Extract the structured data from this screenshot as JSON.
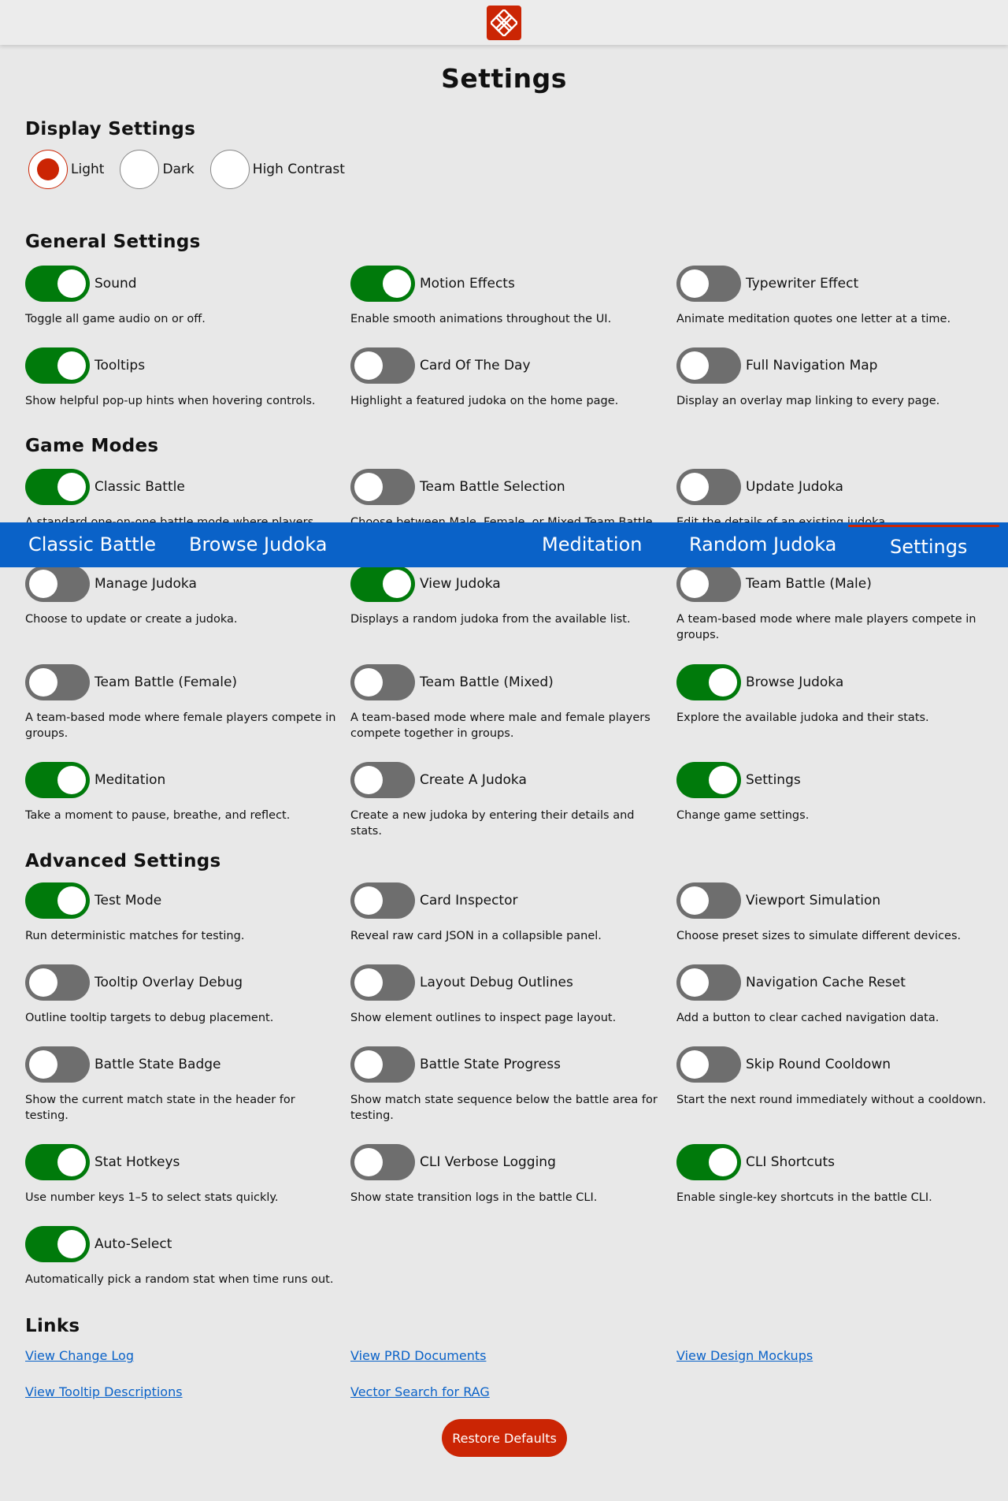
{
  "header": {
    "logo": "knot-logo-icon"
  },
  "page_title": "Settings",
  "display": {
    "title": "Display Settings",
    "modes": [
      {
        "label": "Light",
        "checked": true
      },
      {
        "label": "Dark",
        "checked": false
      },
      {
        "label": "High Contrast",
        "checked": false
      }
    ]
  },
  "general": {
    "title": "General Settings",
    "items": [
      {
        "label": "Sound",
        "desc": "Toggle all game audio on or off.",
        "on": true
      },
      {
        "label": "Motion Effects",
        "desc": "Enable smooth animations throughout the UI.",
        "on": true
      },
      {
        "label": "Typewriter Effect",
        "desc": "Animate meditation quotes one letter at a time.",
        "on": false
      },
      {
        "label": "Tooltips",
        "desc": "Show helpful pop-up hints when hovering controls.",
        "on": true
      },
      {
        "label": "Card Of The Day",
        "desc": "Highlight a featured judoka on the home page.",
        "on": false
      },
      {
        "label": "Full Navigation Map",
        "desc": "Display an overlay map linking to every page.",
        "on": false
      }
    ]
  },
  "game_modes": {
    "title": "Game Modes",
    "items": [
      {
        "label": "Classic Battle",
        "desc": "A standard one-on-one battle mode where players",
        "on": true
      },
      {
        "label": "Team Battle Selection",
        "desc": "Choose between Male, Female, or Mixed Team Battle",
        "on": false
      },
      {
        "label": "Update Judoka",
        "desc": "Edit the details of an existing judoka.",
        "on": false
      },
      {
        "label": "Manage Judoka",
        "desc": "Choose to update or create a judoka.",
        "on": false
      },
      {
        "label": "View Judoka",
        "desc": "Displays a random judoka from the available list.",
        "on": true
      },
      {
        "label": "Team Battle (Male)",
        "desc": "A team-based mode where male players compete in groups.",
        "on": false
      },
      {
        "label": "Team Battle (Female)",
        "desc": "A team-based mode where female players compete in groups.",
        "on": false
      },
      {
        "label": "Team Battle (Mixed)",
        "desc": "A team-based mode where male and female players compete together in groups.",
        "on": false
      },
      {
        "label": "Browse Judoka",
        "desc": "Explore the available judoka and their stats.",
        "on": true
      },
      {
        "label": "Meditation",
        "desc": "Take a moment to pause, breathe, and reflect.",
        "on": true
      },
      {
        "label": "Create A Judoka",
        "desc": "Create a new judoka by entering their details and stats.",
        "on": false
      },
      {
        "label": "Settings",
        "desc": "Change game settings.",
        "on": true
      }
    ]
  },
  "advanced": {
    "title": "Advanced Settings",
    "items": [
      {
        "label": "Test Mode",
        "desc": "Run deterministic matches for testing.",
        "on": true
      },
      {
        "label": "Card Inspector",
        "desc": "Reveal raw card JSON in a collapsible panel.",
        "on": false
      },
      {
        "label": "Viewport Simulation",
        "desc": "Choose preset sizes to simulate different devices.",
        "on": false
      },
      {
        "label": "Tooltip Overlay Debug",
        "desc": "Outline tooltip targets to debug placement.",
        "on": false
      },
      {
        "label": "Layout Debug Outlines",
        "desc": "Show element outlines to inspect page layout.",
        "on": false
      },
      {
        "label": "Navigation Cache Reset",
        "desc": "Add a button to clear cached navigation data.",
        "on": false
      },
      {
        "label": "Battle State Badge",
        "desc": "Show the current match state in the header for testing.",
        "on": false
      },
      {
        "label": "Battle State Progress",
        "desc": "Show match state sequence below the battle area for testing.",
        "on": false
      },
      {
        "label": "Skip Round Cooldown",
        "desc": "Start the next round immediately without a cooldown.",
        "on": false
      },
      {
        "label": "Stat Hotkeys",
        "desc": "Use number keys 1–5 to select stats quickly.",
        "on": true
      },
      {
        "label": "CLI Verbose Logging",
        "desc": "Show state transition logs in the battle CLI.",
        "on": false
      },
      {
        "label": "CLI Shortcuts",
        "desc": "Enable single-key shortcuts in the battle CLI.",
        "on": true
      },
      {
        "label": "Auto-Select",
        "desc": "Automatically pick a random stat when time runs out.",
        "on": true
      }
    ]
  },
  "nav": {
    "items": [
      "Classic Battle",
      "Browse Judoka",
      "Meditation",
      "Random Judoka",
      "Settings"
    ],
    "active": "Settings"
  },
  "links": {
    "title": "Links",
    "items": [
      "View Change Log",
      "View PRD Documents",
      "View Design Mockups",
      "View Tooltip Descriptions",
      "Vector Search for RAG"
    ]
  },
  "restore_label": "Restore Defaults",
  "colors": {
    "accent": "#cb2504",
    "toggle_on": "#007a0b",
    "toggle_off": "#6e6e6e",
    "nav_bg": "#0a62c8",
    "link": "#0a62c8"
  }
}
